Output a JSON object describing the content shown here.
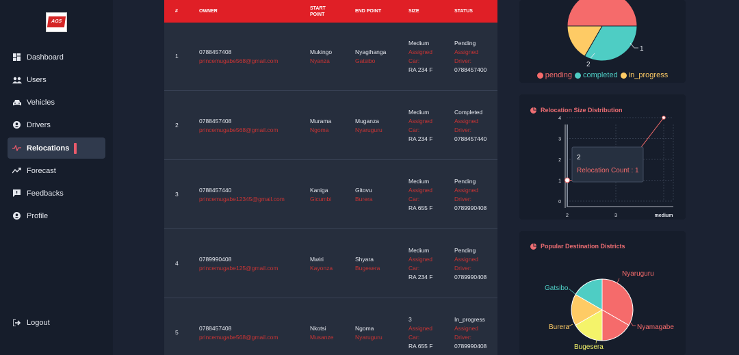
{
  "logo": {
    "text": "AGS"
  },
  "sidebar": {
    "items": [
      {
        "label": "Dashboard",
        "icon": "dashboard-icon"
      },
      {
        "label": "Users",
        "icon": "users-icon"
      },
      {
        "label": "Vehicles",
        "icon": "car-icon"
      },
      {
        "label": "Drivers",
        "icon": "user-circle-icon"
      },
      {
        "label": "Relocations",
        "icon": "relocation-pulse-icon",
        "active": true
      },
      {
        "label": "Forecast",
        "icon": "trend-icon"
      },
      {
        "label": "Feedbacks",
        "icon": "feedback-icon"
      },
      {
        "label": "Profile",
        "icon": "user-circle-icon"
      }
    ],
    "logout": {
      "label": "Logout",
      "icon": "logout-icon"
    }
  },
  "table": {
    "headers": [
      "#",
      "OWNER",
      "START POINT",
      "END POINT",
      "SIZE",
      "STATUS"
    ],
    "rows": [
      {
        "num": "1",
        "phone": "0788457408",
        "email": "princemugabe568@gmail.com",
        "start": "Mukingo",
        "start_district": "Nyanza",
        "end": "Nyagihanga",
        "end_district": "Gatsibo",
        "size": "Medium",
        "assigned": "Assigned",
        "car_label": "Car:",
        "plate": "RA 234 F",
        "status": "Pending",
        "status_assigned": "Assigned",
        "driver_label": "Driver:",
        "driver_phone": "0788457400"
      },
      {
        "num": "2",
        "phone": "0788457408",
        "email": "princemugabe568@gmail.com",
        "start": "Murama",
        "start_district": "Ngoma",
        "end": "Muganza",
        "end_district": "Nyaruguru",
        "size": "Medium",
        "assigned": "Assigned",
        "car_label": "Car:",
        "plate": "RA 234 F",
        "status": "Completed",
        "status_assigned": "Assigned",
        "driver_label": "Driver:",
        "driver_phone": "0788457440"
      },
      {
        "num": "3",
        "phone": "0788457440",
        "email": "princemugabe12345@gmail.com",
        "start": "Kaniga",
        "start_district": "Gicumbi",
        "end": "Gitovu",
        "end_district": "Burera",
        "size": "Medium",
        "assigned": "Assigned",
        "car_label": "Car:",
        "plate": "RA 655 F",
        "status": "Pending",
        "status_assigned": "Assigned",
        "driver_label": "Driver:",
        "driver_phone": "0789990408"
      },
      {
        "num": "4",
        "phone": "0789990408",
        "email": "princemugabe125@gmail.com",
        "start": "Mwiri",
        "start_district": "Kayonza",
        "end": "Shyara",
        "end_district": "Bugesera",
        "size": "Medium",
        "assigned": "Assigned",
        "car_label": "Car:",
        "plate": "RA 234 F",
        "status": "Pending",
        "status_assigned": "Assigned",
        "driver_label": "Driver:",
        "driver_phone": "0789990408"
      },
      {
        "num": "5",
        "phone": "0788457408",
        "email": "princemugabe568@gmail.com",
        "start": "Nkotsi",
        "start_district": "Musanze",
        "end": "Ngoma",
        "end_district": "Nyaruguru",
        "size": "3",
        "assigned": "Assigned",
        "car_label": "Car:",
        "plate": "RA 655 F",
        "status": "In_progress",
        "status_assigned": "Assigned",
        "driver_label": "Driver:",
        "driver_phone": "0789990408"
      }
    ]
  },
  "colors": {
    "pending": "#f56b6b",
    "completed": "#4ecdc4",
    "in_progress": "#fecb65",
    "accent_red": "#e01f26",
    "bugesera": "#f4f36a"
  },
  "chart_data": [
    {
      "type": "pie",
      "title": "",
      "categories": [
        "pending",
        "completed",
        "in_progress"
      ],
      "values": [
        3,
        2,
        1
      ],
      "data_labels": [
        "",
        "2",
        "1"
      ],
      "legend": "bottom"
    },
    {
      "type": "line",
      "title": "Relocation Size Distribution",
      "categories": [
        "2",
        "3",
        "medium"
      ],
      "series": [
        {
          "name": "Relocation Count",
          "values": [
            1,
            1,
            4
          ]
        }
      ],
      "ylim": [
        0,
        4
      ],
      "yticks": [
        "0",
        "1",
        "2",
        "3",
        "4"
      ],
      "grid": true,
      "tooltip": {
        "title": "2",
        "label": "Relocation Count",
        "value": "1"
      }
    },
    {
      "type": "pie",
      "title": "Popular Destination Districts",
      "categories": [
        "Nyaruguru",
        "Nyamagabe",
        "Bugesera",
        "Burera",
        "Gatsibo"
      ],
      "values": [
        2,
        1,
        1,
        1,
        1
      ],
      "colors": [
        "#f56b6b",
        "#f56b6b",
        "#f4f36a",
        "#fecb65",
        "#4ecdc4"
      ]
    }
  ]
}
